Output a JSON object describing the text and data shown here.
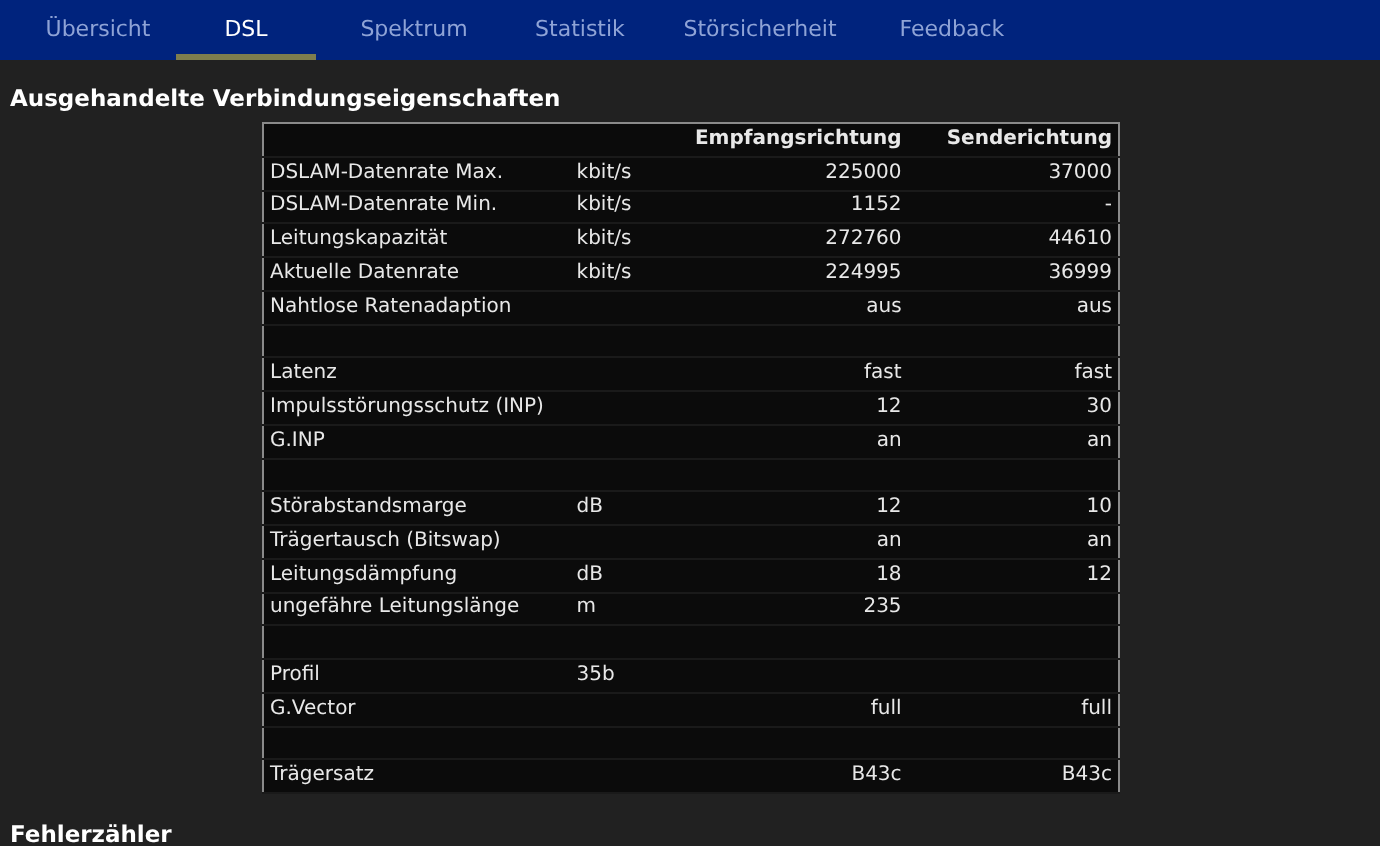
{
  "tabs": [
    {
      "label": "Übersicht",
      "selected": false
    },
    {
      "label": "DSL",
      "selected": true
    },
    {
      "label": "Spektrum",
      "selected": false
    },
    {
      "label": "Statistik",
      "selected": false
    },
    {
      "label": "Störsicherheit",
      "selected": false
    },
    {
      "label": "Feedback",
      "selected": false
    }
  ],
  "section_title": "Ausgehandelte Verbindungseigenschaften",
  "table": {
    "columns": [
      "Empfangsrichtung",
      "Senderichtung"
    ],
    "rows": [
      {
        "kind": "data",
        "label": "DSLAM-Datenrate Max.",
        "unit": "kbit/s",
        "down": "225000",
        "up": "37000"
      },
      {
        "kind": "data",
        "label": "DSLAM-Datenrate Min.",
        "unit": "kbit/s",
        "down": "1152",
        "up": "-"
      },
      {
        "kind": "data",
        "label": "Leitungskapazität",
        "unit": "kbit/s",
        "down": "272760",
        "up": "44610"
      },
      {
        "kind": "data",
        "label": "Aktuelle Datenrate",
        "unit": "kbit/s",
        "down": "224995",
        "up": "36999"
      },
      {
        "kind": "data",
        "label": "Nahtlose Ratenadaption",
        "down": "aus",
        "up": "aus"
      },
      {
        "kind": "spacer"
      },
      {
        "kind": "data",
        "label": "Latenz",
        "down": "fast",
        "up": "fast"
      },
      {
        "kind": "data",
        "label": "Impulsstörungsschutz (INP)",
        "down": "12",
        "up": "30"
      },
      {
        "kind": "data",
        "label": "G.INP",
        "down": "an",
        "up": "an"
      },
      {
        "kind": "spacer"
      },
      {
        "kind": "data",
        "label": "Störabstandsmarge",
        "unit": "dB",
        "down": "12",
        "up": "10"
      },
      {
        "kind": "data",
        "label": "Trägertausch (Bitswap)",
        "down": "an",
        "up": "an"
      },
      {
        "kind": "data",
        "label": "Leitungsdämpfung",
        "unit": "dB",
        "down": "18",
        "up": "12"
      },
      {
        "kind": "data",
        "label": "ungefähre Leitungslänge",
        "unit": "m",
        "down": "235"
      },
      {
        "kind": "spacer"
      },
      {
        "kind": "data",
        "label": "Profil",
        "unit": "35b"
      },
      {
        "kind": "data",
        "label": "G.Vector",
        "down": "full",
        "up": "full"
      },
      {
        "kind": "spacer"
      },
      {
        "kind": "data",
        "label": "Trägersatz",
        "down": "B43c",
        "up": "B43c"
      }
    ]
  },
  "next_section_title": "Fehlerzähler"
}
